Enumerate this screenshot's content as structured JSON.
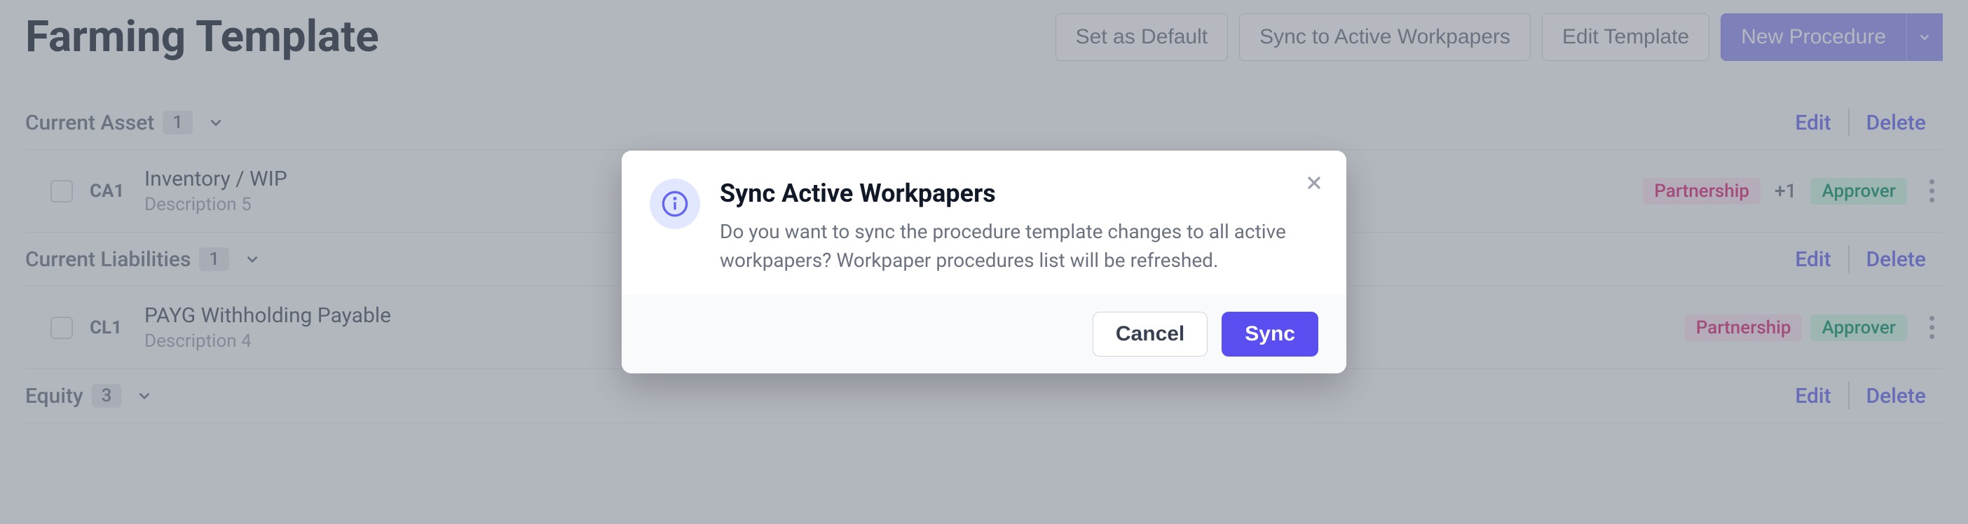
{
  "header": {
    "title": "Farming Template",
    "actions": {
      "set_default": "Set as Default",
      "sync": "Sync to Active Workpapers",
      "edit_template": "Edit Template",
      "new_procedure": "New Procedure"
    }
  },
  "section_actions": {
    "edit": "Edit",
    "delete": "Delete"
  },
  "sections": [
    {
      "title": "Current Asset",
      "count": "1",
      "items": [
        {
          "code": "CA1",
          "title": "Inventory / WIP",
          "description": "Description 5",
          "tag_partnership": "Partnership",
          "plus": "+1",
          "tag_approver": "Approver"
        }
      ]
    },
    {
      "title": "Current Liabilities",
      "count": "1",
      "items": [
        {
          "code": "CL1",
          "title": "PAYG Withholding Payable",
          "description": "Description 4",
          "tag_partnership": "Partnership",
          "tag_approver": "Approver"
        }
      ]
    },
    {
      "title": "Equity",
      "count": "3"
    }
  ],
  "modal": {
    "title": "Sync Active Workpapers",
    "description": "Do you want to sync the procedure template changes to all active workpapers? Workpaper procedures list will be refreshed.",
    "cancel": "Cancel",
    "confirm": "Sync"
  }
}
